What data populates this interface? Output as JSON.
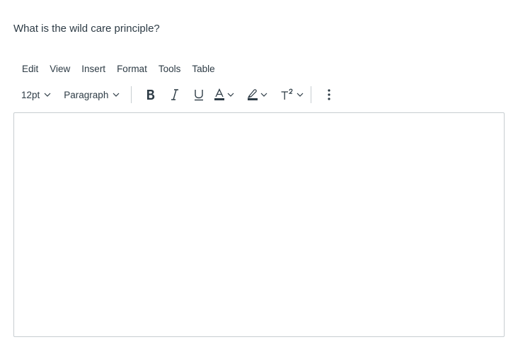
{
  "question": {
    "text": "What is the wild care principle?"
  },
  "menubar": {
    "items": [
      {
        "label": "Edit"
      },
      {
        "label": "View"
      },
      {
        "label": "Insert"
      },
      {
        "label": "Format"
      },
      {
        "label": "Tools"
      },
      {
        "label": "Table"
      }
    ]
  },
  "toolbar": {
    "font_size": "12pt",
    "block_format": "Paragraph",
    "icons": {
      "bold": "bold-icon",
      "italic": "italic-icon",
      "underline": "underline-icon",
      "text_color": "text-color-icon",
      "highlight": "highlight-color-icon",
      "superscript": "superscript-icon",
      "more": "more-vertical-icon"
    },
    "colors": {
      "icon": "#2d3b45",
      "separator": "#c7cdd1"
    }
  },
  "editor": {
    "border_color": "#c7cdd1"
  }
}
